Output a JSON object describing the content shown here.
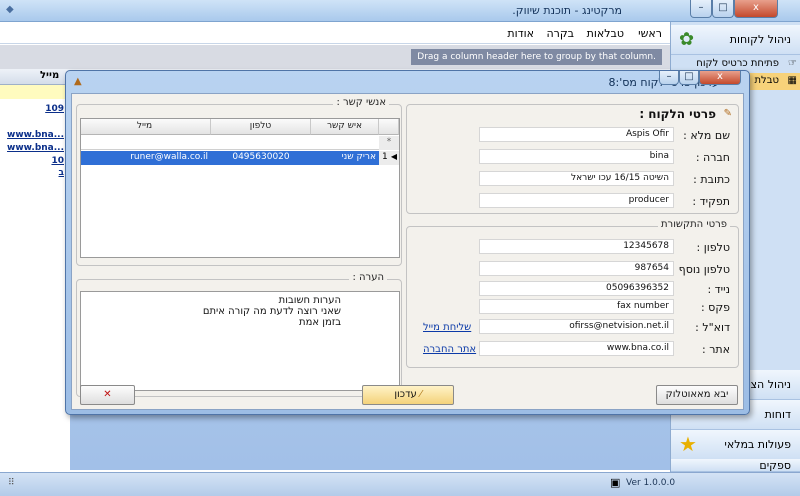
{
  "app": {
    "title": "מרקטינג - תוכנת שיווק.",
    "close_label": "x",
    "maximize_label": "□",
    "minimize_label": "–"
  },
  "menu": {
    "items": [
      "ראשי",
      "טבלאות",
      "בקרה",
      "אודות"
    ]
  },
  "grid_bg": {
    "group_hint": "Drag a column header here to group by that column.",
    "email_col": "מייל",
    "left_values": [
      "109",
      "www.bna...",
      "www.bna...",
      "10",
      "ב"
    ]
  },
  "sidebar": {
    "manage_customers": "ניהול לקוחות",
    "open_cards": "פתיחת כרטיס לקוח",
    "table_partial": "טבלת",
    "manage_offers": "ניהול הצע",
    "reports": "דוחות",
    "bulk_actions": "פעולות במלאי",
    "suppliers": "ספקים"
  },
  "status": {
    "version": "Ver 1.0.0.0"
  },
  "dialog": {
    "title": "עדכון פרטי לקוח מס':8",
    "details_heading": "פרטי הלקוח :",
    "comm_legend": "פרטי התקשורת",
    "fields": {
      "full_name_label": "שם מלא :",
      "full_name": "Aspis Ofir",
      "company_label": "חברה :",
      "company": "bina",
      "address_label": "כתובת :",
      "address": "השיטה 16/15 עכו ישראל",
      "role_label": "תפקיד :",
      "role": "producer",
      "phone_label": "טלפון :",
      "phone": "12345678",
      "phone2_label": "טלפון נוסף :",
      "phone2": "987654",
      "mobile_label": "נייד :",
      "mobile": "05096396352",
      "fax_label": "פקס :",
      "fax": "fax number",
      "email_label": "דוא\"ל :",
      "email": "ofirss@netvision.net.il",
      "site_label": "אתר :",
      "site": "www.bna.co.il"
    },
    "send_mail_link": "שליחת מייל",
    "company_site_link": "אתר החברה",
    "contacts_legend": "אנשי קשר :",
    "contacts_columns": [
      "מייל",
      "טלפון",
      "איש קשר"
    ],
    "contacts_rows": [
      {
        "num": "1",
        "name": "אריק שני",
        "phone": "0495630020",
        "email": "runer@walla.co.il"
      }
    ],
    "new_row_marker": "*",
    "notes_legend": "הערה :",
    "notes_lines": [
      "הערות חשובות",
      "שאני רוצה לדעת מה קורה איתם",
      "בזמן אמת"
    ],
    "import_button": "יבא מאאוטלוק",
    "update_button": "עדכון",
    "cancel_button": "✕"
  },
  "colors": {
    "accent": "#a9c9ec",
    "dialog_body": "#f3f1ec",
    "selected_row": "#2f6fd6",
    "link": "#0b3aa8"
  }
}
